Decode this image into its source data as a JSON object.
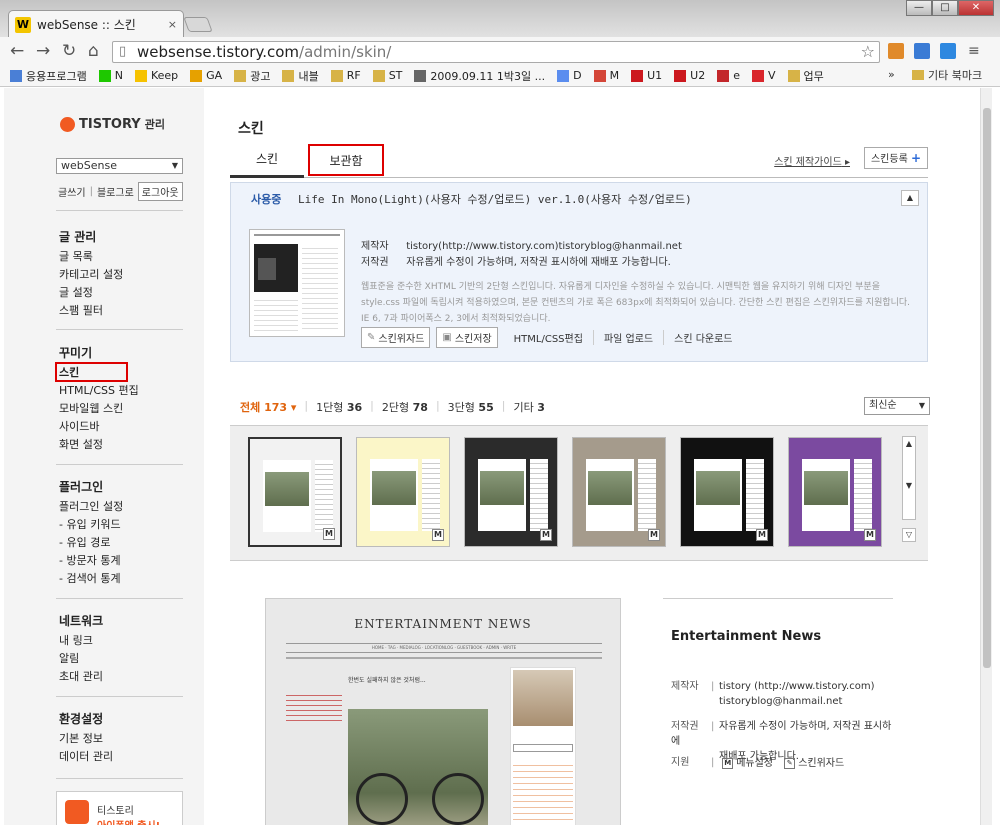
{
  "browser": {
    "tab_title": "webSense :: 스킨",
    "tab_close": "×",
    "favicon": "W",
    "url_host": "websense.tistory.com",
    "url_path": "/admin/skin/",
    "bookmarks": [
      {
        "label": "응용프로그램",
        "color": "#4a7fd6"
      },
      {
        "label": "N",
        "color": "#1ec800"
      },
      {
        "label": "Keep",
        "color": "#f6c200"
      },
      {
        "label": "GA",
        "color": "#e6a100"
      },
      {
        "label": "광고",
        "color": "#d7b347"
      },
      {
        "label": "내블",
        "color": "#d7b347"
      },
      {
        "label": "RF",
        "color": "#d7b347"
      },
      {
        "label": "ST",
        "color": "#d7b347"
      },
      {
        "label": "2009.09.11 1박3일 ...",
        "color": "#666666"
      },
      {
        "label": "D",
        "color": "#5b8def"
      },
      {
        "label": "M",
        "color": "#d44638"
      },
      {
        "label": "U1",
        "color": "#cc181e"
      },
      {
        "label": "U2",
        "color": "#cc181e"
      },
      {
        "label": "e",
        "color": "#c3272b"
      },
      {
        "label": "V",
        "color": "#d9262c"
      },
      {
        "label": "업무",
        "color": "#d7b347"
      }
    ],
    "bookmarks_more": "»",
    "other_bookmarks": "기타 북마크"
  },
  "sidebar": {
    "logo": "TISTORY",
    "logo_suffix": "관리",
    "blog_select": "webSense",
    "links": {
      "write": "글쓰기",
      "sep": "|",
      "blog": "블로그로",
      "logout": "로그아웃"
    },
    "groups": [
      {
        "head": "글 관리",
        "items": [
          "글 목록",
          "카테고리 설정",
          "글 설정",
          "스팸 필터"
        ]
      },
      {
        "head": "꾸미기",
        "items": [
          "스킨",
          "HTML/CSS 편집",
          "모바일웹 스킨",
          "사이드바",
          "화면 설정"
        ]
      },
      {
        "head": "플러그인",
        "items": [
          "플러그인 설정",
          "- 유입 키워드",
          "- 유입 경로",
          "- 방문자 통계",
          "- 검색어 통계"
        ]
      },
      {
        "head": "네트워크",
        "items": [
          "내 링크",
          "알림",
          "초대 관리"
        ]
      },
      {
        "head": "환경설정",
        "items": [
          "기본 정보",
          "데이터 관리"
        ]
      }
    ],
    "promo_line1": "티스토리",
    "promo_line2": "아이폰앱 출시!"
  },
  "main": {
    "title": "스킨",
    "tab_skin": "스킨",
    "tab_storage": "보관함",
    "guide_link": "스킨 제작가이드",
    "register_button": "스킨등록",
    "using": {
      "label": "사용중",
      "name": "Life In Mono(Light)(사용자 수정/업로드) ver.1.0(사용자 수정/업로드)",
      "author_key": "제작자",
      "author_val": "tistory(http://www.tistory.com)tistoryblog@hanmail.net",
      "copyright_key": "저작권",
      "copyright_val": "자유롭게 수정이 가능하며, 저작권 표시하에 재배포 가능합니다.",
      "desc": "웹표준을 준수한 XHTML 기반의 2단형 스킨입니다. 자유롭게 디자인을 수정하실 수 있습니다. 시맨틱한 웹을 유지하기 위해 디자인 부분을 style.css 파일에 독립시켜 적용하였으며, 본문 컨텐츠의 가로 폭은 683px에 최적화되어 있습니다. 간단한 스킨 편집은 스킨위자드를 지원합니다. IE 6, 7과 파이어폭스 2, 3에서 최적화되었습니다.",
      "btn_wizard": "스킨위자드",
      "btn_save": "스킨저장",
      "link_html": "HTML/CSS편집",
      "link_upload": "파일 업로드",
      "link_download": "스킨 다운로드"
    },
    "filters": {
      "all": "전체 173",
      "one": "1단형",
      "one_n": "36",
      "two": "2단형",
      "two_n": "78",
      "three": "3단형",
      "three_n": "55",
      "etc": "기타",
      "etc_n": "3"
    },
    "sort": "최신순",
    "thumb_badge": "M",
    "preview": {
      "title": "ENTERTAINMENT NEWS",
      "post": "한번도 실패하지 않은 것처럼..."
    },
    "info": {
      "name": "Entertainment News",
      "author_key": "제작자",
      "author_val": "tistory (http://www.tistory.com)",
      "author_mail": "tistoryblog@hanmail.net",
      "copyright_key": "저작권",
      "copyright_val": "자유롭게 수정이 가능하며, 저작권 표시하에",
      "copyright_val2": "재배포 가능합니다.",
      "support_key": "지원",
      "support_menu": "메뉴설정",
      "support_wizard": "스킨위자드"
    }
  },
  "colors": {
    "accent": "#f15a22",
    "highlight": "#d00000",
    "link_blue": "#2b5ba8"
  }
}
